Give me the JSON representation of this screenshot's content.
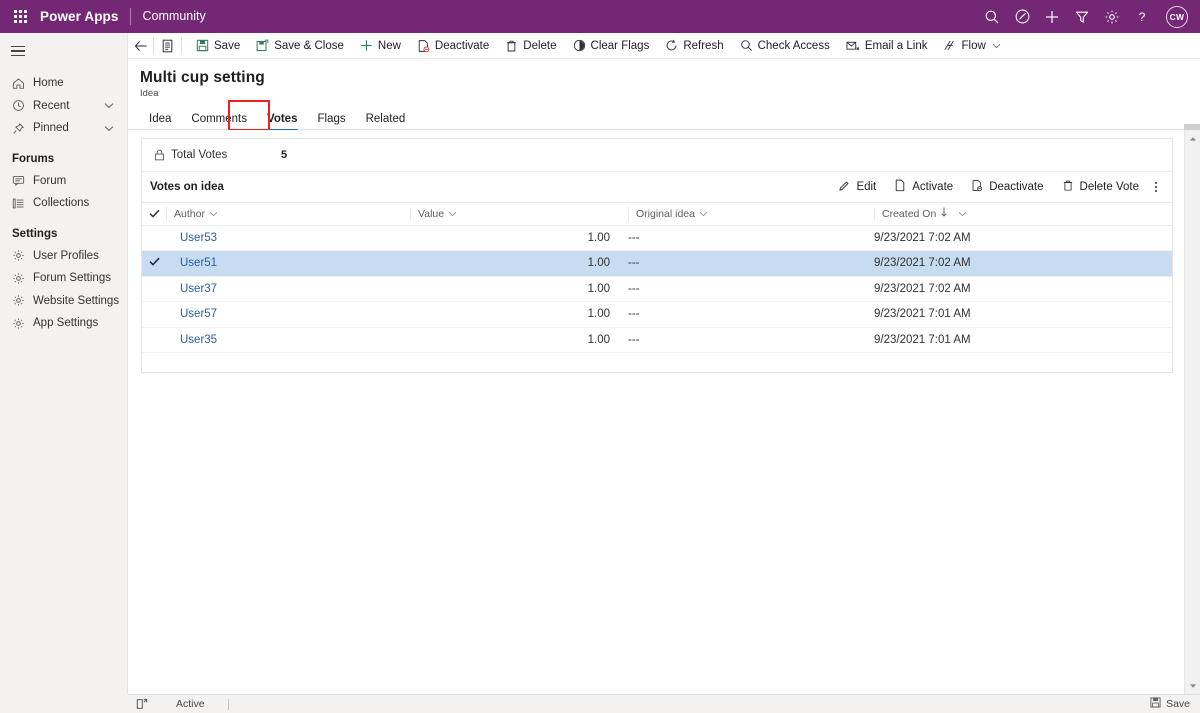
{
  "appbar": {
    "waffle": "app-launcher",
    "brand": "Power Apps",
    "app_name": "Community",
    "icons": [
      "search-icon",
      "badge-icon",
      "plus-icon",
      "filter-icon",
      "gear-icon",
      "help-icon"
    ],
    "avatar_initials": "CW",
    "background": "#742774"
  },
  "sidebar": {
    "hamburger": "site-map-toggle",
    "items": [
      {
        "label": "Home",
        "icon": "home-icon",
        "chevron": false
      },
      {
        "label": "Recent",
        "icon": "clock-icon",
        "chevron": true
      },
      {
        "label": "Pinned",
        "icon": "pin-icon",
        "chevron": true
      }
    ],
    "groups": [
      {
        "title": "Forums",
        "items": [
          {
            "label": "Forum",
            "icon": "forum-icon"
          },
          {
            "label": "Collections",
            "icon": "list-icon"
          }
        ]
      },
      {
        "title": "Settings",
        "items": [
          {
            "label": "User Profiles",
            "icon": "gear-icon"
          },
          {
            "label": "Forum Settings",
            "icon": "gear-icon"
          },
          {
            "label": "Website Settings",
            "icon": "gear-icon"
          },
          {
            "label": "App Settings",
            "icon": "gear-icon"
          }
        ]
      }
    ]
  },
  "commandbar": {
    "back": "back-arrow-icon",
    "form_selector": "form-icon",
    "buttons": [
      {
        "label": "Save",
        "icon": "save-icon"
      },
      {
        "label": "Save & Close",
        "icon": "save-close-icon"
      },
      {
        "label": "New",
        "icon": "plus-icon"
      },
      {
        "label": "Deactivate",
        "icon": "deactivate-icon"
      },
      {
        "label": "Delete",
        "icon": "trash-icon"
      },
      {
        "label": "Clear Flags",
        "icon": "clear-flags-icon"
      },
      {
        "label": "Refresh",
        "icon": "refresh-icon"
      },
      {
        "label": "Check Access",
        "icon": "check-access-icon"
      },
      {
        "label": "Email a Link",
        "icon": "email-link-icon"
      },
      {
        "label": "Flow",
        "icon": "flow-icon",
        "chevron": true
      }
    ]
  },
  "record": {
    "title": "Multi cup setting",
    "subtitle": "Idea",
    "tabs": [
      {
        "label": "Idea",
        "active": false
      },
      {
        "label": "Comments",
        "active": false
      },
      {
        "label": "Votes",
        "active": true,
        "annotated": true
      },
      {
        "label": "Flags",
        "active": false
      },
      {
        "label": "Related",
        "active": false
      }
    ],
    "annotation_color": "#f02020",
    "active_tab_underline_color": "#2266c2"
  },
  "form": {
    "total_votes": {
      "label": "Total Votes",
      "value": "5",
      "icon": "lock-icon",
      "readonly": true
    }
  },
  "subgrid": {
    "title": "Votes on idea",
    "commands": [
      {
        "label": "Edit",
        "icon": "pencil-icon"
      },
      {
        "label": "Activate",
        "icon": "activate-icon"
      },
      {
        "label": "Deactivate",
        "icon": "deactivate-icon"
      },
      {
        "label": "Delete Vote",
        "icon": "trash-icon"
      }
    ],
    "overflow": "more-commands-icon",
    "columns": [
      {
        "label": "Author",
        "sorted": false
      },
      {
        "label": "Value",
        "sorted": false
      },
      {
        "label": "Original idea",
        "sorted": false
      },
      {
        "label": "Created On",
        "sorted": true,
        "sort_direction": "desc"
      }
    ],
    "rows": [
      {
        "selected": false,
        "author": "User53",
        "value": "1.00",
        "original_idea": "---",
        "created_on": "9/23/2021 7:02 AM"
      },
      {
        "selected": true,
        "author": "User51",
        "value": "1.00",
        "original_idea": "---",
        "created_on": "9/23/2021 7:02 AM"
      },
      {
        "selected": false,
        "author": "User37",
        "value": "1.00",
        "original_idea": "---",
        "created_on": "9/23/2021 7:02 AM"
      },
      {
        "selected": false,
        "author": "User57",
        "value": "1.00",
        "original_idea": "---",
        "created_on": "9/23/2021 7:01 AM"
      },
      {
        "selected": false,
        "author": "User35",
        "value": "1.00",
        "original_idea": "---",
        "created_on": "9/23/2021 7:01 AM"
      }
    ],
    "selected_row_color": "#c7dcf0",
    "link_color": "#265ea4"
  },
  "footer": {
    "icon": "unsaved-icon",
    "status": "Active",
    "save_label": "Save",
    "save_icon": "save-icon"
  }
}
